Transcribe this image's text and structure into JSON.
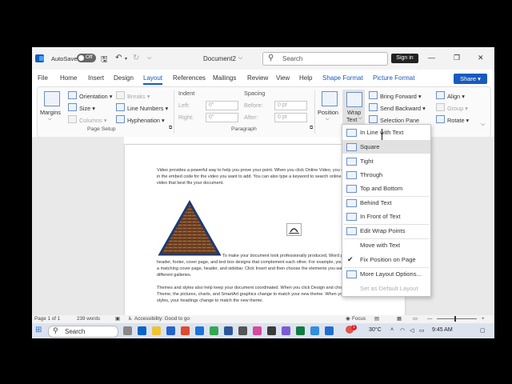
{
  "titlebar": {
    "autosave_label": "AutoSave",
    "toggle_label": "Off",
    "document_title": "Document2",
    "search_placeholder": "Search",
    "signin_label": "Sign in"
  },
  "menu": {
    "tabs": [
      "File",
      "Home",
      "Insert",
      "Design",
      "Layout",
      "References",
      "Mailings",
      "Review",
      "View",
      "Help",
      "Shape Format",
      "Picture Format"
    ],
    "active_tab": "Layout",
    "share_label": "Share"
  },
  "ribbon": {
    "page_setup": {
      "margins": "Margins",
      "orientation": "Orientation",
      "size": "Size",
      "columns": "Columns",
      "breaks": "Breaks",
      "line_numbers": "Line Numbers",
      "hyphenation": "Hyphenation",
      "group_name": "Page Setup"
    },
    "paragraph": {
      "indent": "Indent",
      "spacing": "Spacing",
      "left_label": "Left:",
      "right_label": "Right:",
      "before_label": "Before:",
      "after_label": "After:",
      "left_value": "0\"",
      "right_value": "0\"",
      "before_value": "0 pt",
      "after_value": "0 pt",
      "group_name": "Paragraph"
    },
    "arrange": {
      "position": "Position",
      "wrap_text_1": "Wrap",
      "wrap_text_2": "Text",
      "bring_forward": "Bring Forward",
      "send_backward": "Send Backward",
      "selection_pane": "Selection Pane",
      "align": "Align",
      "group": "Group",
      "rotate": "Rotate"
    }
  },
  "document": {
    "para1": "Video provides a powerful way to help you prove your point. When you click Online Video, you can paste in the embed code for the video you want to add. You can also type a keyword to search online for the video that best fits your document.",
    "para2": "To make your document look professionally produced, Word provides header, footer, cover page, and text box designs that complement each other. For example, you can add a matching cover page, header, and sidebar. Click Insert and then choose the elements you want from the different galleries.",
    "para3": "Themes and styles also help keep your document coordinated. When you click Design and choose a new Theme, the pictures, charts, and SmartArt graphics change to match your new theme. When you apply styles, your headings change to match the new theme."
  },
  "wrap_menu": {
    "items": [
      "In Line with Text",
      "Square",
      "Tight",
      "Through",
      "Top and Bottom",
      "Behind Text",
      "In Front of Text",
      "Edit Wrap Points",
      "Move with Text",
      "Fix Position on Page",
      "More Layout Options...",
      "Set as Default Layout"
    ]
  },
  "status": {
    "page": "Page 1 of 1",
    "words": "239 words",
    "accessibility": "Accessibility: Good to go",
    "focus": "Focus"
  },
  "taskbar": {
    "search": "Search",
    "temperature": "30°C",
    "time": "9:45 AM",
    "notification_count": "1"
  },
  "colors": {
    "accent": "#185abd",
    "triangle_border": "#1f3a6e",
    "wood": "#7a4a2a"
  }
}
